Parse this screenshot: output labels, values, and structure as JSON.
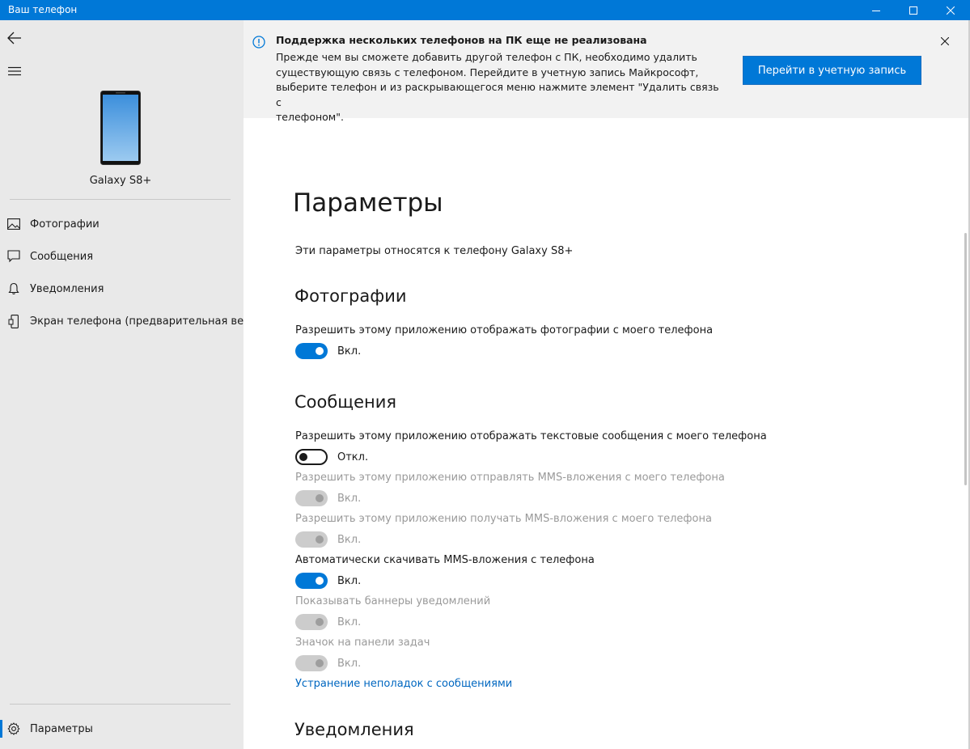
{
  "window": {
    "title": "Ваш телефон"
  },
  "sidebar": {
    "device_name": "Galaxy S8+",
    "items": [
      {
        "label": "Фотографии",
        "icon": "photo-icon"
      },
      {
        "label": "Сообщения",
        "icon": "message-icon"
      },
      {
        "label": "Уведомления",
        "icon": "bell-icon"
      },
      {
        "label": "Экран телефона (предварительная версия)",
        "icon": "phone-screen-icon"
      }
    ],
    "settings": {
      "label": "Параметры",
      "icon": "gear-icon"
    }
  },
  "banner": {
    "title": "Поддержка нескольких телефонов на ПК еще не реализована",
    "lines": [
      "Прежде чем вы сможете добавить другой телефон с ПК, необходимо удалить",
      "существующую связь с телефоном. Перейдите в учетную запись Майкрософт,",
      "выберите телефон и из раскрывающегося меню нажмите элемент \"Удалить связь с",
      "телефоном\"."
    ],
    "action_label": "Перейти в учетную запись"
  },
  "main": {
    "title": "Параметры",
    "subtitle": "Эти параметры относятся к телефону Galaxy S8+",
    "photos": {
      "heading": "Фотографии",
      "settings": [
        {
          "label": "Разрешить этому приложению отображать фотографии с моего телефона",
          "state": "Вкл."
        }
      ]
    },
    "messages": {
      "heading": "Сообщения",
      "settings": [
        {
          "label": "Разрешить этому приложению отображать текстовые сообщения с моего телефона",
          "state": "Откл."
        },
        {
          "label": "Разрешить этому приложению отправлять MMS-вложения с моего телефона",
          "state": "Вкл."
        },
        {
          "label": "Разрешить этому приложению получать MMS-вложения с моего телефона",
          "state": "Вкл."
        },
        {
          "label": "Автоматически скачивать MMS-вложения с телефона",
          "state": "Вкл."
        },
        {
          "label": "Показывать баннеры уведомлений",
          "state": "Вкл."
        },
        {
          "label": "Значок на панели задач",
          "state": "Вкл."
        }
      ],
      "troubleshoot_link": "Устранение неполадок с сообщениями"
    },
    "notifications": {
      "heading": "Уведомления"
    }
  },
  "colors": {
    "accent": "#0078d7",
    "link": "#0067c0",
    "sidebar_bg": "#e9e9e9",
    "banner_bg": "#f2f2f2",
    "disabled_text": "#9a9a9a"
  }
}
